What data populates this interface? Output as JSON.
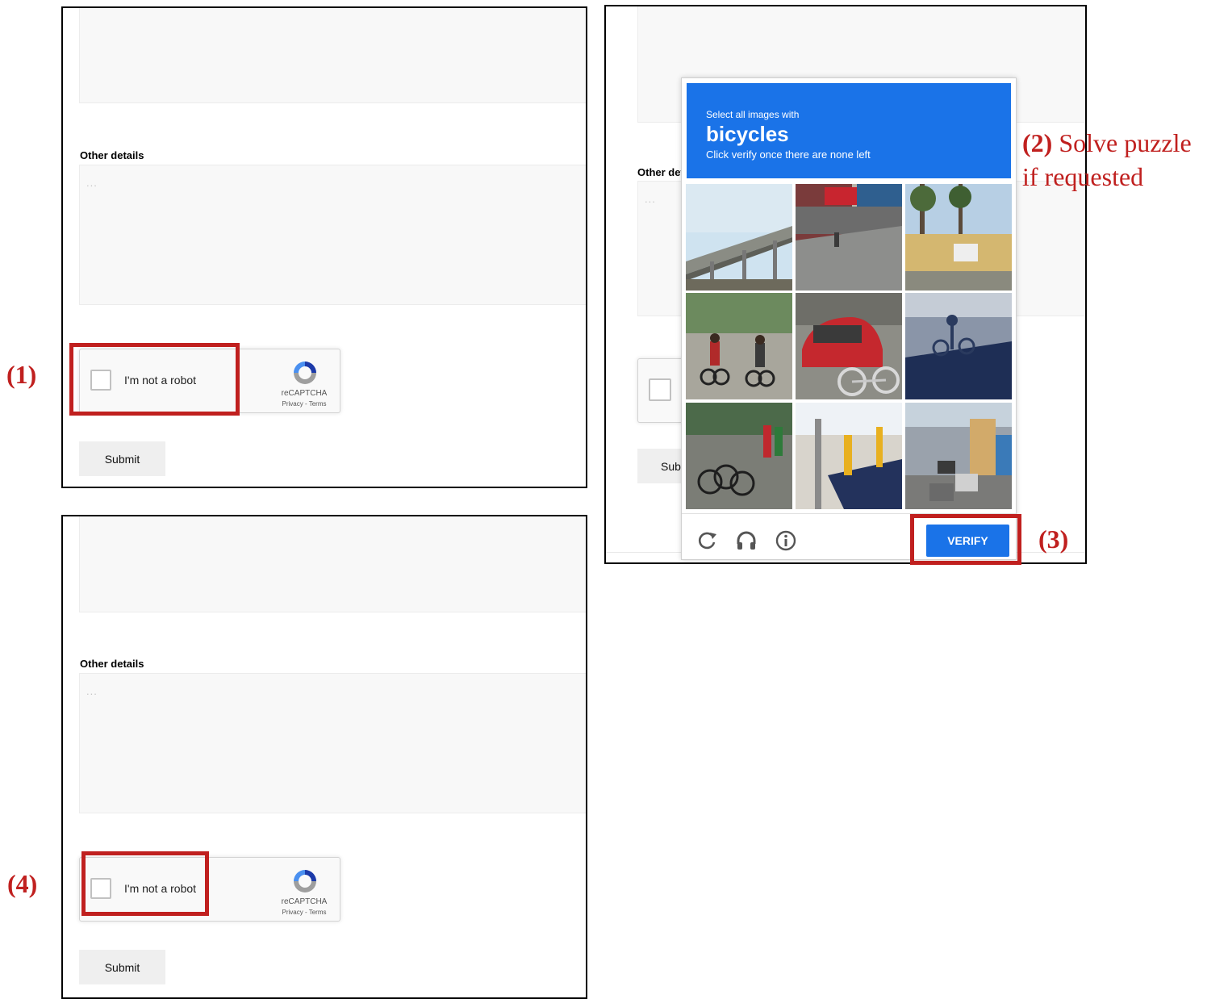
{
  "step_labels": {
    "step1": "(1)",
    "step3": "(3)",
    "step4": "(4)"
  },
  "annotation": {
    "step2_number": "(2)",
    "step2_text_line1": "Solve puzzle",
    "step2_text_line2": "if requested"
  },
  "form": {
    "other_details_label": "Other details",
    "other_details_placeholder": "...",
    "submit_label": "Submit",
    "other_details_label_cropped": "Other det",
    "submit_label_cropped": "Sub"
  },
  "recaptcha": {
    "checkbox_label": "I'm not a robot",
    "brand": "reCAPTCHA",
    "links": "Privacy - Terms"
  },
  "challenge": {
    "instruction": "Select all images with",
    "keyword": "bicycles",
    "hint": "Click verify once there are none left",
    "verify_label": "VERIFY",
    "icons": [
      "reload-icon",
      "headphones-icon",
      "info-icon"
    ],
    "tiles": [
      "elevated-highway",
      "storefront-street",
      "trees-building",
      "children-riding-bicycles",
      "parked-car-and-bicycle",
      "bicycle-shadow",
      "parked-bicycles",
      "bollards-sidewalk",
      "traffic-street"
    ]
  },
  "colors": {
    "annotation_red": "#c0201f",
    "verify_blue": "#1a73e8"
  }
}
